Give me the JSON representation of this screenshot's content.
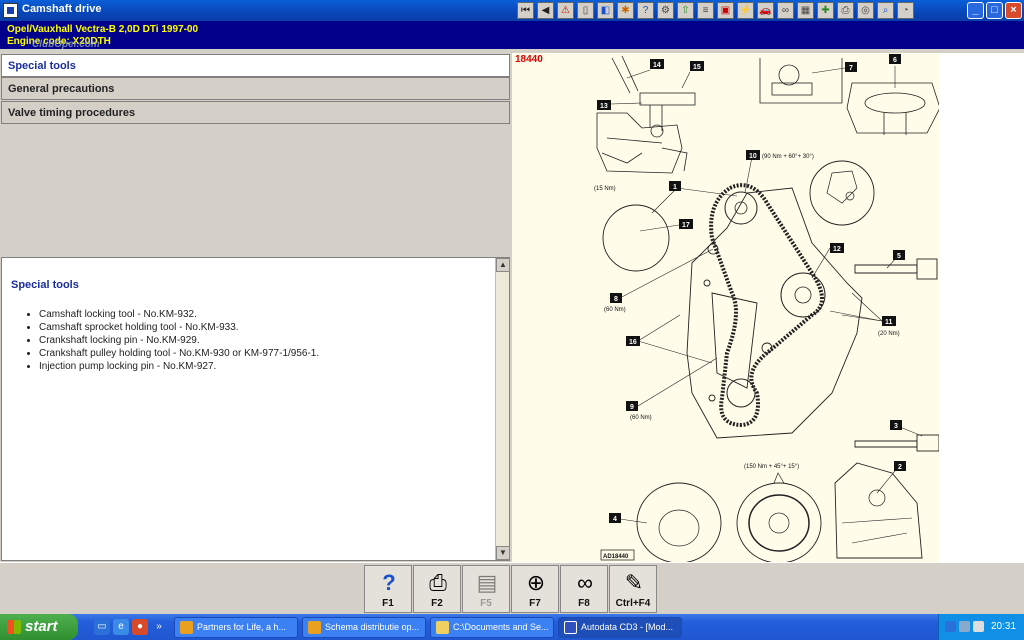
{
  "window": {
    "title": "Camshaft drive"
  },
  "toolbar_icons": [
    "navigation-first-icon",
    "navigation-back-icon",
    "warning-icon",
    "page-icon",
    "manual-icon",
    "tools-icon",
    "help-icon",
    "engine-icon",
    "lift-icon",
    "settings-icon",
    "battery-icon",
    "electrical-icon",
    "car-icon",
    "belt-icon",
    "chart-icon",
    "service-icon",
    "printer-icon",
    "wheel-icon",
    "search-icon",
    "gauge-icon"
  ],
  "vehicle": {
    "line1": "Opel/Vauxhall   Vectra-B  2,0D DTi 1997-00",
    "line2": "Engine code: X20DTH",
    "watermark": "ClubOpel.com"
  },
  "nav": {
    "items": [
      {
        "label": "Special tools"
      },
      {
        "label": "General precautions"
      },
      {
        "label": "Valve timing procedures"
      }
    ]
  },
  "content": {
    "heading": "Special tools",
    "items": [
      "Camshaft locking tool - No.KM-932.",
      "Camshaft sprocket holding tool - No.KM-933.",
      "Crankshaft locking pin - No.KM-929.",
      "Crankshaft pulley holding tool - No.KM-930 or KM-977-1/956-1.",
      "Injection pump locking pin - No.KM-927."
    ]
  },
  "diagram": {
    "image_number": "18440",
    "callouts": [
      "14",
      "15",
      "13",
      "7",
      "6",
      "10",
      "1",
      "17",
      "12",
      "5",
      "8",
      "11",
      "16",
      "9",
      "3",
      "2",
      "4"
    ],
    "torques": {
      "t10": "(90 Nm + 60°+ 30°)",
      "t1": "(15 Nm)",
      "t8": "(60 Nm)",
      "t11": "(20 Nm)",
      "t9": "(60 Nm)",
      "t_pulley": "(150 Nm + 45°+ 15°)"
    },
    "figure_code": "AD18440"
  },
  "fn_keys": [
    {
      "label": "F1",
      "icon": "help-icon",
      "enabled": true
    },
    {
      "label": "F2",
      "icon": "printer-icon",
      "enabled": true
    },
    {
      "label": "F5",
      "icon": "manual-icon",
      "enabled": false
    },
    {
      "label": "F7",
      "icon": "crosshair-icon",
      "enabled": true
    },
    {
      "label": "F8",
      "icon": "belt-icon",
      "enabled": true
    },
    {
      "label": "Ctrl+F4",
      "icon": "notepad-icon",
      "enabled": true
    }
  ],
  "taskbar": {
    "start_label": "start",
    "tasks": [
      {
        "label": "Partners for Life, a h...",
        "color": "#e8a020"
      },
      {
        "label": "Schema distributie op...",
        "color": "#e8a020"
      },
      {
        "label": "C:\\Documents and Se...",
        "color": "#f0d060"
      },
      {
        "label": "Autodata CD3 - [Mod...",
        "color": "#3050c0"
      }
    ],
    "clock": "20:31"
  }
}
